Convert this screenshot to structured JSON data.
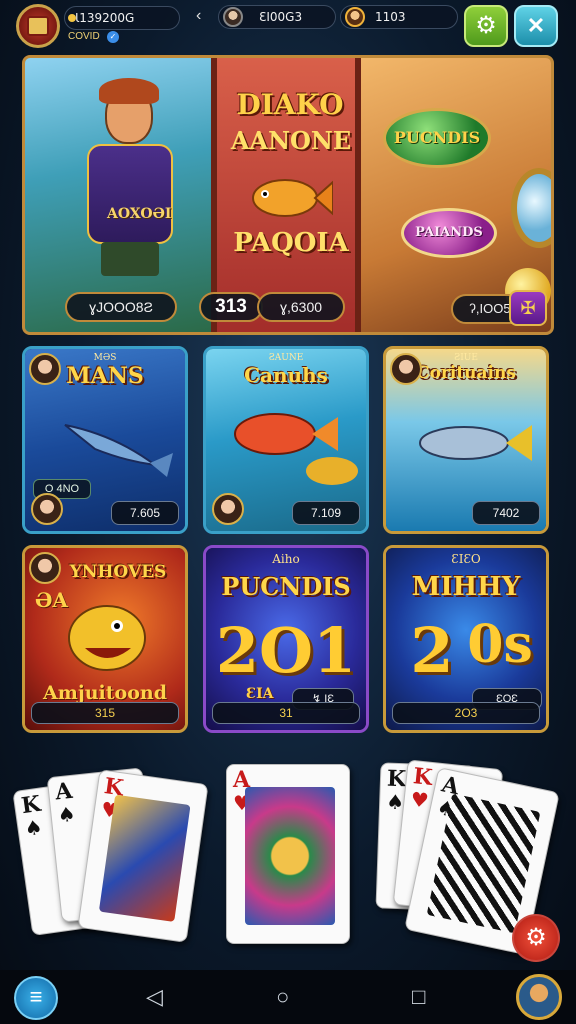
{
  "topbar": {
    "coins_value": "Ɩ139200G",
    "status_text": "COVID",
    "player2_value": "ƐI00G3",
    "player3_value": "1103",
    "back_glyph": "‹",
    "settings_glyph": "⚙",
    "close_glyph": "✕"
  },
  "hero": {
    "title_line1": "DIAKO",
    "title_line2": "AANONE",
    "title_line3": "PAQOIA",
    "belt_text": "AOXOƏI",
    "badge_green": "PUCNDIS",
    "badge_purple": "PAIANDS",
    "pill_a": "ɣJOOO8Ƨ",
    "pill_b": "313",
    "pill_c": "ɣ,6300",
    "pill_d": "ʔ,IOO5",
    "corner_glyph": "✠"
  },
  "tiles": [
    {
      "small": "MƏS",
      "name": "MANS",
      "value": "7.605",
      "chip": "O 4NO"
    },
    {
      "small": "ƧAUNE",
      "name": "Canuhs",
      "value": "7.109"
    },
    {
      "small": "ƧIUE",
      "name": "Corituains",
      "value": "7402"
    },
    {
      "name": "YNHOVES",
      "sub_top": "ƏA",
      "sub": "Amjuitoond",
      "value": "315"
    },
    {
      "small": "Aiho",
      "name": "PUCNDIS",
      "big": "2O1",
      "sub": "ƐIA",
      "pill": "↯ IƐ",
      "value": "31"
    },
    {
      "small": "ƐIƐO",
      "name": "MIHHY",
      "big": "2",
      "big2": "0s",
      "pill": "ƐOƐ",
      "value": "2O3"
    }
  ],
  "cards": {
    "left_a": {
      "rank": "K",
      "suit": "♠"
    },
    "left_b": {
      "rank": "A",
      "suit": "♠"
    },
    "left_c": {
      "rank": "K",
      "suit": "♥"
    },
    "center": {
      "rank": "A",
      "suit": "♥"
    },
    "right_a": {
      "rank": "K",
      "suit": "♠"
    },
    "right_b": {
      "rank": "K",
      "suit": "♥"
    },
    "right_c": {
      "rank": "A",
      "suit": "♠"
    }
  },
  "bottom": {
    "menu_glyph": "≡",
    "back_glyph": "◁",
    "home_glyph": "○",
    "recent_glyph": "□",
    "fab_glyph": "⚙"
  },
  "colors": {
    "accent_gold": "#c08a3a",
    "tile_border_blue": "#3aa0c8",
    "tile_border_gold": "#c89a3a",
    "settings_green": "#6fbf2a",
    "close_cyan": "#2bb0cc"
  }
}
